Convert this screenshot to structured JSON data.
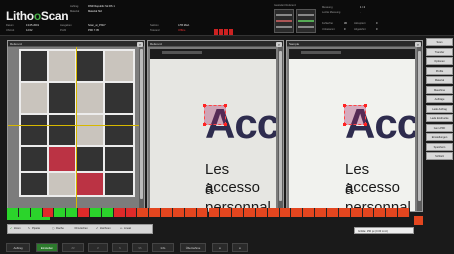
{
  "header": {
    "logo_main": "Litho",
    "logo_o": "o",
    "logo_tail": "Scan",
    "left_rows": [
      {
        "label": "Auftrag",
        "value": "RNR Republic Str.RS 1"
      },
      {
        "label": "Material",
        "value": "Material Std"
      }
    ],
    "info_rows": [
      {
        "label": "Datum",
        "value": "13.05.2019"
      },
      {
        "label": "Uhrzeit",
        "value": "12:02"
      }
    ],
    "mid_rows": [
      {
        "label": "Ausgaben",
        "value": "Scan_at_PNG*"
      },
      {
        "label": "Profil",
        "value": "PDF 7.05"
      }
    ],
    "status_rows": [
      {
        "label": "Sektion",
        "value": "4.55 Mod."
      },
      {
        "label": "Toleranz",
        "value": "Offline"
      }
    ],
    "reference_label": "Geändert Referenz",
    "measure_rows": [
      {
        "label": "Messung",
        "value": "1 / 2"
      },
      {
        "label": "Letzte Messung",
        "value": "·"
      }
    ],
    "counters": [
      {
        "label": "Fehlerfrei",
        "value": "30",
        "label2": "Akzeptiert",
        "value2": "0"
      },
      {
        "label": "Unbekannt",
        "value": "0",
        "label2": "Abgelehnt",
        "value2": "0"
      }
    ]
  },
  "panels": {
    "reference": {
      "title": "Referenz"
    },
    "difference": {
      "title": "Referenz"
    },
    "sample": {
      "title": "Sample"
    }
  },
  "document": {
    "headline": "Acce",
    "line1": "Les accesso",
    "line2": "à personnal"
  },
  "toolbar": {
    "items": [
      "Zoom",
      "Pipette",
      "Flache",
      "Löschen",
      "Zeichnen",
      "Lineal"
    ]
  },
  "status": {
    "info": "Größe: 150 px (0.00 mm²)"
  },
  "sidebar": {
    "buttons": [
      "Scan",
      "Transfer",
      "Optionen",
      "Profile",
      "Material",
      "Maschine",
      "Aufträge",
      "Lade Auftrag",
      "Lade Eindrucke",
      "Gem.PDF",
      "Einstellungen",
      "Speichern",
      "Schließ"
    ]
  },
  "bottom": {
    "buttons": [
      "Auftrag",
      "Einstellen",
      "<<",
      "<",
      ">",
      ">>",
      "Info",
      "Übernahme",
      "≡",
      "≡"
    ]
  },
  "colors": {
    "accent_green": "#2bd42b",
    "accent_red": "#e02a2a",
    "headline": "#2e2c4e"
  }
}
